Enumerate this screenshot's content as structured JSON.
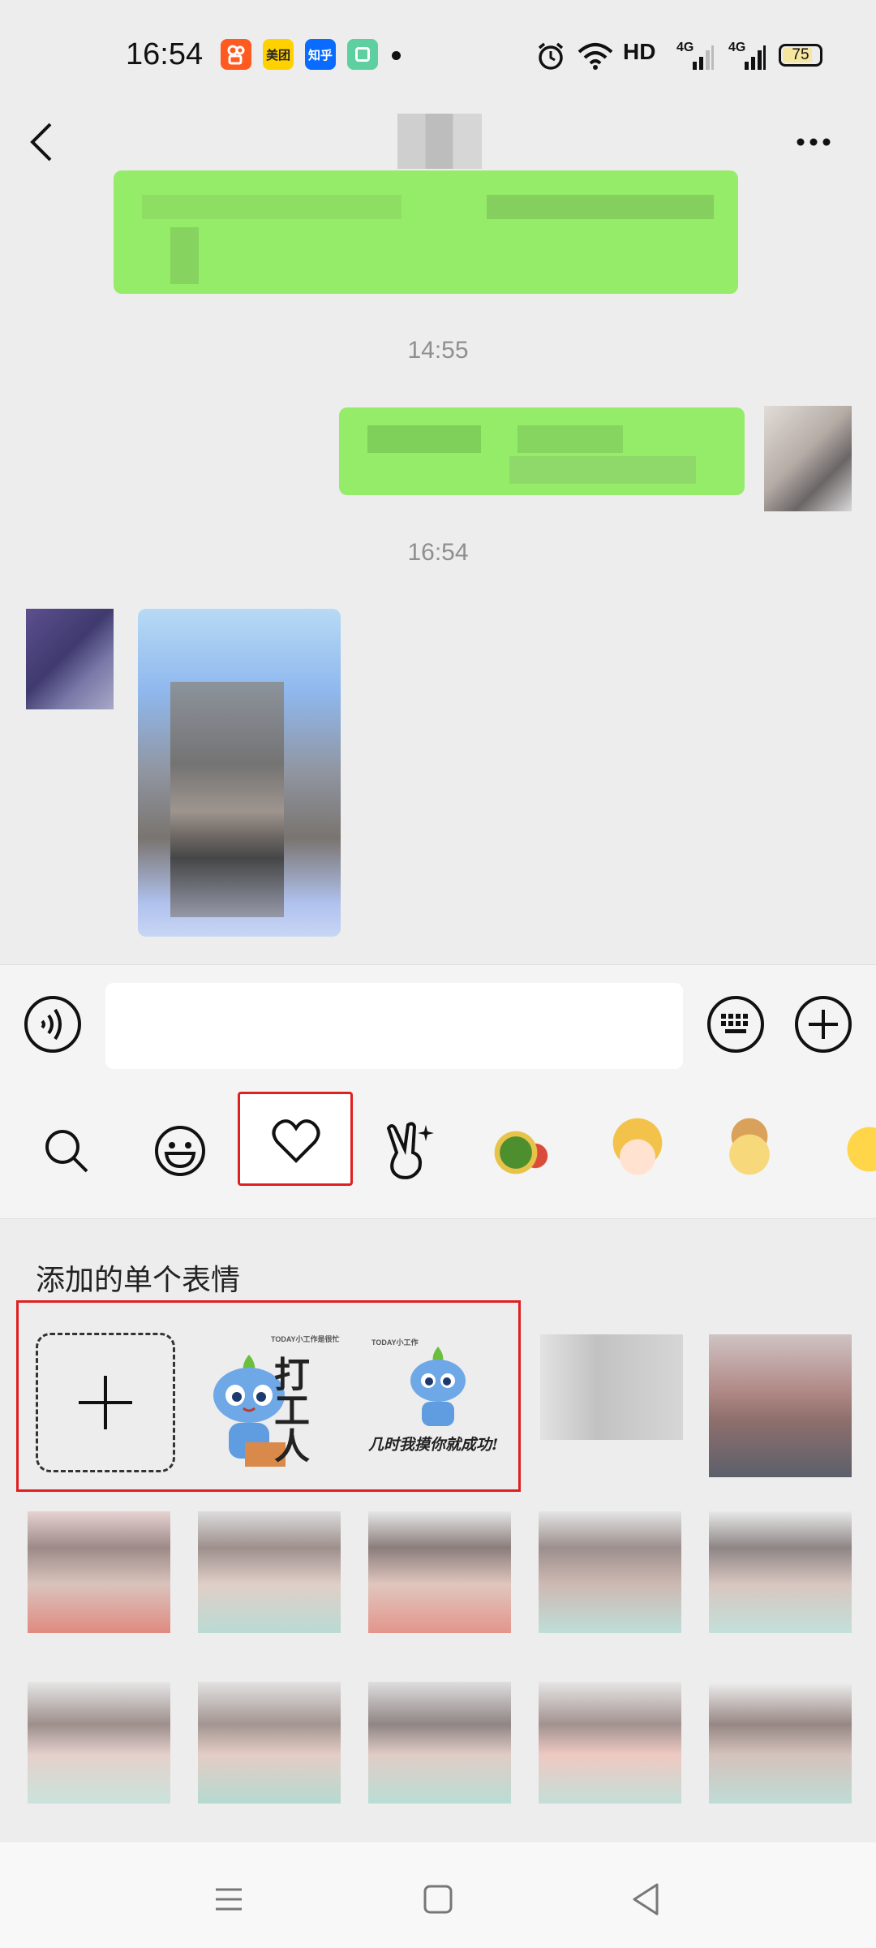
{
  "status_bar": {
    "time": "16:54",
    "apps": [
      {
        "name": "kuaishou-icon",
        "label": "",
        "color": "#ff5a1f"
      },
      {
        "name": "meituan-icon",
        "label": "美团",
        "color": "#ffd100"
      },
      {
        "name": "zhihu-icon",
        "label": "知乎",
        "color": "#0a6cff"
      },
      {
        "name": "green-app-icon",
        "label": "",
        "color": "#5ed0a0"
      }
    ],
    "network": "HD",
    "signal_1": "4G",
    "signal_2": "4G",
    "battery": "75"
  },
  "chat": {
    "timestamps": [
      "14:55",
      "16:54"
    ],
    "colors": {
      "outgoing_bubble": "#95ec69",
      "background": "#ededed"
    }
  },
  "input_bar": {
    "placeholder": ""
  },
  "emoji_tabs": [
    "search-tab",
    "emoji-tab",
    "favorites-tab",
    "gesture-sticker-tab",
    "christmas-sticker-tab",
    "girl-sticker-tab",
    "bear-sticker-tab",
    "yellow-face-tab"
  ],
  "sticker_panel": {
    "section_title": "添加的单个表情",
    "sticker_1": {
      "big": "打工人",
      "small": "TODAY小工作是很忙"
    },
    "sticker_2": {
      "big": "几时我摸你就成功!",
      "small": "TODAY小工作"
    }
  },
  "highlight_color": "#e02020"
}
